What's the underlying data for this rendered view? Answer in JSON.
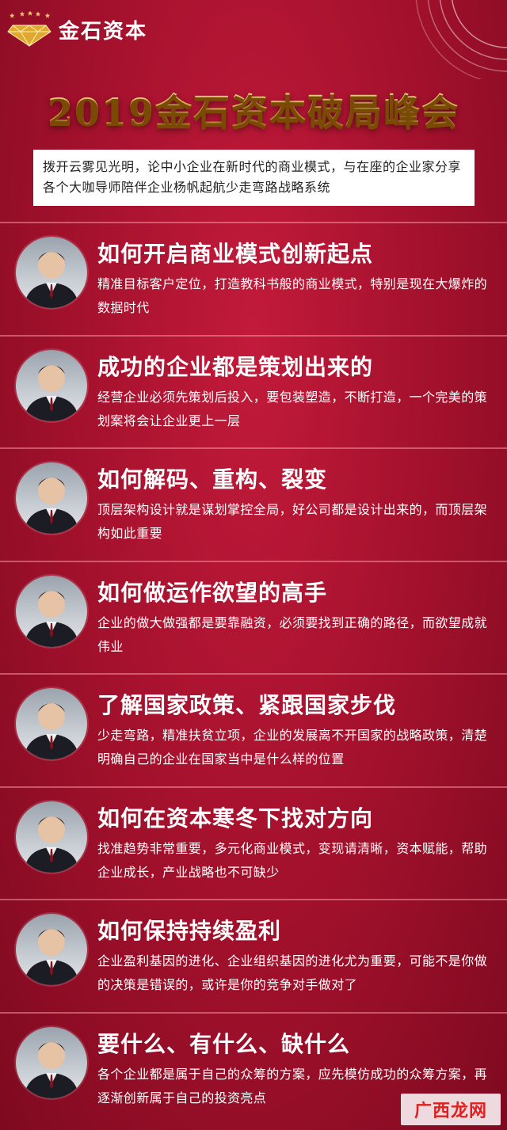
{
  "brand": {
    "name": "金石资本",
    "logo_icon": "diamond-icon"
  },
  "title": "2019金石资本破局峰会",
  "intro": "拨开云雾见光明，论中小企业在新时代的商业模式，与在座的企业家分享各个大咖导师陪伴企业杨帆起航少走弯路战略系统",
  "items": [
    {
      "heading": "如何开启商业模式创新起点",
      "desc": "精准目标客户定位，打造教科书般的商业模式，特别是现在大爆炸的数据时代"
    },
    {
      "heading": "成功的企业都是策划出来的",
      "desc": "经营企业必须先策划后投入，要包装塑造，不断打造，一个完美的策划案将会让企业更上一层"
    },
    {
      "heading": "如何解码、重构、裂变",
      "desc": "顶层架构设计就是谋划掌控全局，好公司都是设计出来的，而顶层架构如此重要"
    },
    {
      "heading": "如何做运作欲望的高手",
      "desc": "企业的做大做强都是要靠融资，必须要找到正确的路径，而欲望成就伟业"
    },
    {
      "heading": "了解国家政策、紧跟国家步伐",
      "desc": "少走弯路，精准扶贫立项，企业的发展离不开国家的战略政策，清楚明确自己的企业在国家当中是什么样的位置"
    },
    {
      "heading": "如何在资本寒冬下找对方向",
      "desc": "找准趋势非常重要，多元化商业模式，变现请清晰，资本赋能，帮助企业成长，产业战略也不可缺少"
    },
    {
      "heading": "如何保持持续盈利",
      "desc": "企业盈利基因的进化、企业组织基因的进化尤为重要，可能不是你做的决策是错误的，或许是你的竞争对手做对了"
    },
    {
      "heading": "要什么、有什么、缺什么",
      "desc": "各个企业都是属于自己的众筹的方案，应先模仿成功的众筹方案，再逐渐创新属于自己的投资亮点"
    }
  ],
  "watermark": "广西龙网"
}
